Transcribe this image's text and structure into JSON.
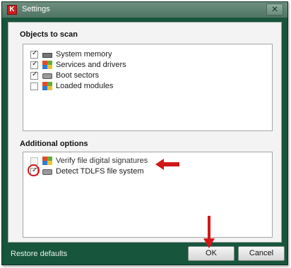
{
  "window": {
    "title": "Settings",
    "close_symbol": "✕",
    "app_icon": "K"
  },
  "objects_section": {
    "title": "Objects to scan",
    "items": [
      {
        "label": "System memory",
        "checked": true,
        "icon": "memory-icon"
      },
      {
        "label": "Services and drivers",
        "checked": true,
        "icon": "windows-flag-icon"
      },
      {
        "label": "Boot sectors",
        "checked": true,
        "icon": "disk-icon"
      },
      {
        "label": "Loaded modules",
        "checked": false,
        "icon": "windows-flag-icon"
      }
    ]
  },
  "additional_section": {
    "title": "Additional options",
    "items": [
      {
        "label": "Verify file digital signatures",
        "checked": false,
        "enabled": false,
        "icon": "windows-flag-icon"
      },
      {
        "label": "Detect TDLFS file system",
        "checked": true,
        "enabled": true,
        "icon": "disk-icon"
      }
    ]
  },
  "footer": {
    "restore_label": "Restore defaults",
    "ok_label": "OK",
    "cancel_label": "Cancel"
  },
  "colors": {
    "frame": "#17553c",
    "annotation": "#d01818"
  }
}
